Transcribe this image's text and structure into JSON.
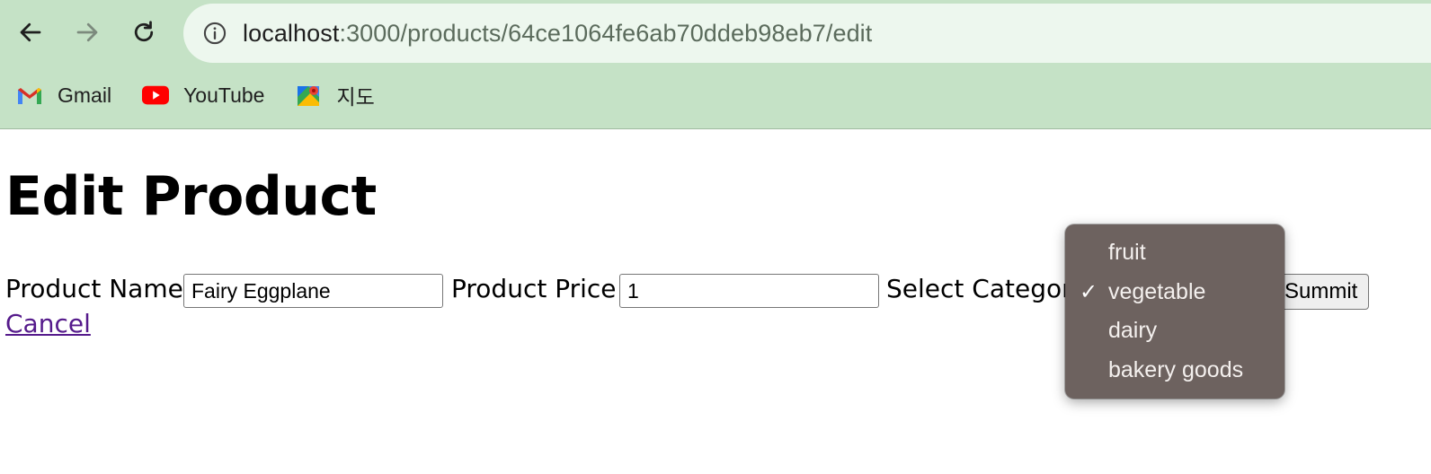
{
  "browser": {
    "url_host": "localhost",
    "url_rest": ":3000/products/64ce1064fe6ab70ddeb98eb7/edit",
    "bookmarks": [
      {
        "label": "Gmail",
        "icon": "gmail-icon"
      },
      {
        "label": "YouTube",
        "icon": "youtube-icon"
      },
      {
        "label": "지도",
        "icon": "maps-icon"
      }
    ]
  },
  "page": {
    "title": "Edit Product",
    "product_name_label": "Product Name",
    "product_name_value": "Fairy Eggplane",
    "product_price_label": "Product Price",
    "product_price_value": "1",
    "category_label": "Select Category",
    "submit_label": "Summit",
    "cancel_label": "Cancel"
  },
  "category_dropdown": {
    "selected": "vegetable",
    "options": [
      "fruit",
      "vegetable",
      "dairy",
      "bakery goods"
    ],
    "check_glyph": "✓"
  },
  "colors": {
    "chrome_bg": "#c5e2c6",
    "omnibox_bg": "#edf7ee",
    "dropdown_bg": "#6d625f",
    "link_visited": "#551a8b"
  }
}
